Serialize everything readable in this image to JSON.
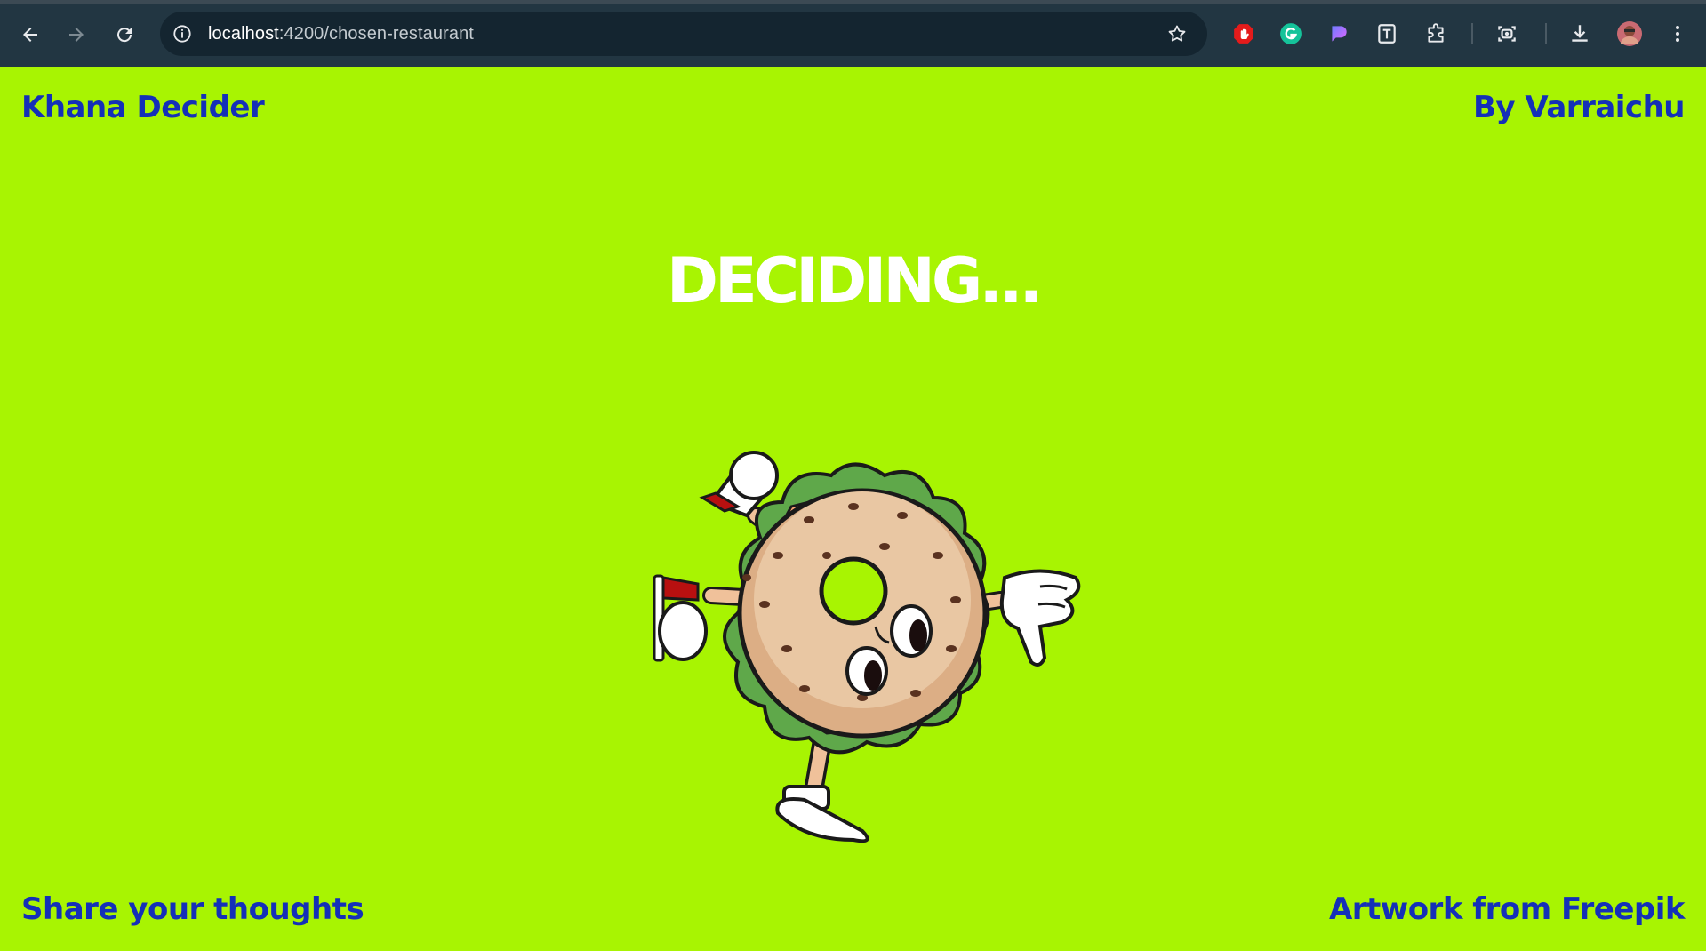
{
  "browser": {
    "url_host": "localhost",
    "url_path": ":4200/chosen-restaurant"
  },
  "header": {
    "app_title": "Khana Decider",
    "author": "By Varraichu"
  },
  "main": {
    "status_heading": "DECIDING...",
    "mascot_icon": "bagel-mascot-icon"
  },
  "footer": {
    "feedback_link": "Share your thoughts",
    "credit_link": "Artwork from Freepik"
  },
  "colors": {
    "page_bg": "#a8f402",
    "accent_text": "#1430b8",
    "heading_text": "#ffffff",
    "browser_bar": "#223642"
  }
}
